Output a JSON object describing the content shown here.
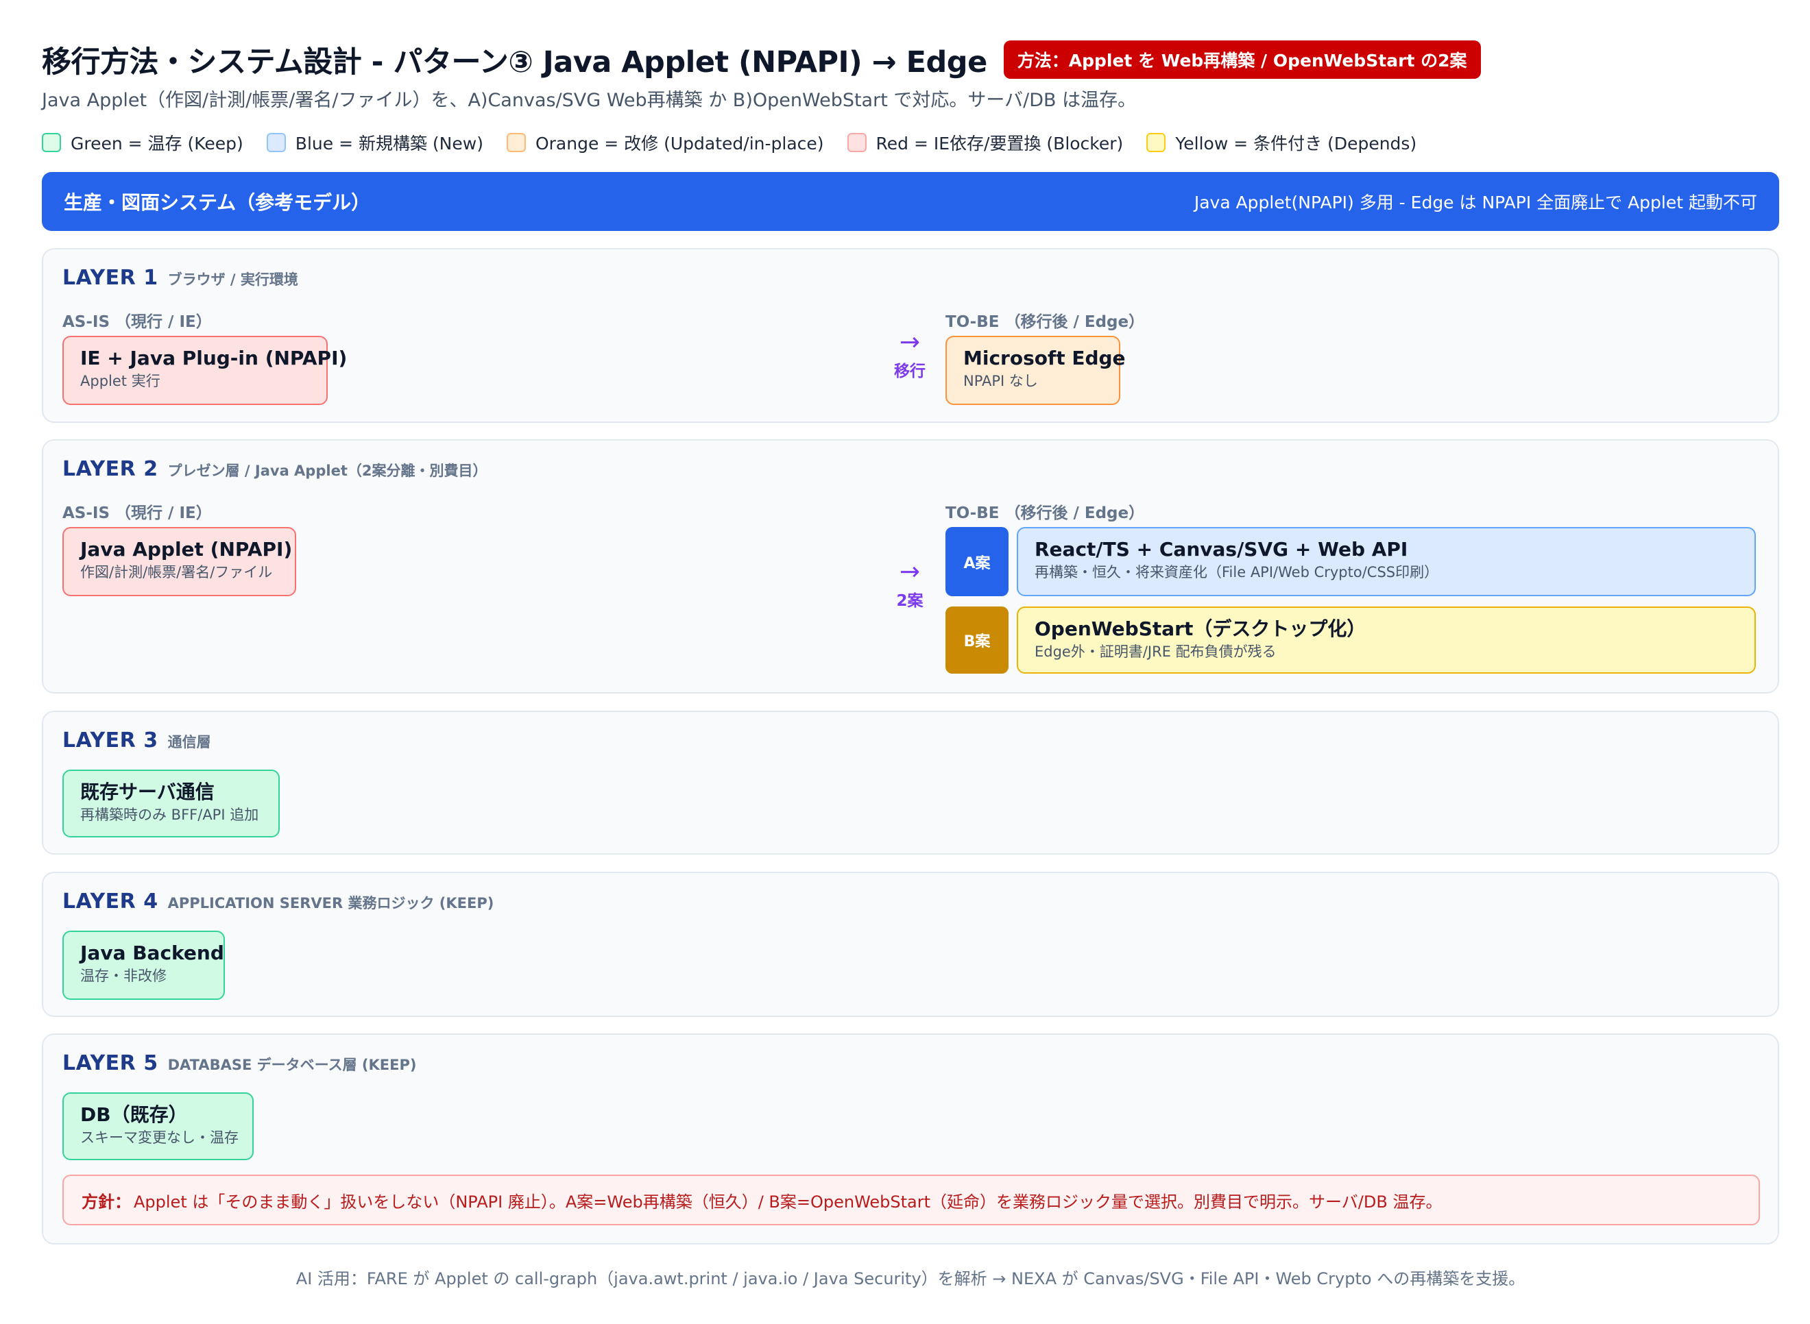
{
  "header": {
    "title": "移行方法・システム設計 - パターン③ Java Applet (NPAPI) → Edge",
    "method_badge": "方法：Applet を Web再構築 / OpenWebStart の2案",
    "subtitle": "Java Applet（作図/計測/帳票/署名/ファイル）を、A)Canvas/SVG Web再構築 か B)OpenWebStart で対応。サーバ/DB は温存。"
  },
  "legend": [
    {
      "label": "Green = 温存 (Keep)",
      "color": "#34d399"
    },
    {
      "label": "Blue = 新規構築 (New)",
      "color": "#93c5fd"
    },
    {
      "label": "Orange = 改修 (Updated/in-place)",
      "color": "#fdba74"
    },
    {
      "label": "Red = IE依存/要置換 (Blocker)",
      "color": "#fca5a5"
    },
    {
      "label": "Yellow = 条件付き (Depends)",
      "color": "#facc15"
    }
  ],
  "system": {
    "title": "生産・図面システム（参考モデル）",
    "note": "Java Applet(NPAPI) 多用 - Edge は NPAPI 全面廃止で Applet 起動不可"
  },
  "columns": {
    "as_is": "AS-IS （現行 / IE）",
    "to_be": "TO-BE （移行後 / Edge）"
  },
  "layers": {
    "l1": {
      "num": "LAYER 1",
      "desc": "ブラウザ / 実行環境",
      "as_is": {
        "title": "IE + Java Plug-in (NPAPI)",
        "sub": "Applet 実行"
      },
      "arrow": {
        "glyph": "→",
        "label": "移行"
      },
      "to_be": {
        "title": "Microsoft Edge",
        "sub": "NPAPI なし"
      }
    },
    "l2": {
      "num": "LAYER 2",
      "desc": "プレゼン層 / Java Applet（2案分離・別費目）",
      "as_is": {
        "title": "Java Applet (NPAPI)",
        "sub": "作図/計測/帳票/署名/ファイル"
      },
      "arrow": {
        "glyph": "→",
        "label": "2案"
      },
      "option_a": {
        "tag": "A案",
        "title": "React/TS + Canvas/SVG + Web API",
        "sub": "再構築・恒久・将来資産化（File API/Web Crypto/CSS印刷）"
      },
      "option_b": {
        "tag": "B案",
        "title": "OpenWebStart（デスクトップ化）",
        "sub": "Edge外・証明書/JRE 配布負債が残る"
      }
    },
    "l3": {
      "num": "LAYER 3",
      "desc": "通信層",
      "node": {
        "title": "既存サーバ通信",
        "sub": "再構築時のみ BFF/API 追加"
      }
    },
    "l4": {
      "num": "LAYER 4",
      "desc": "APPLICATION SERVER 業務ロジック (KEEP)",
      "node": {
        "title": "Java Backend",
        "sub": "温存・非改修"
      }
    },
    "l5": {
      "num": "LAYER 5",
      "desc": "DATABASE データベース層 (KEEP)",
      "node": {
        "title": "DB（既存）",
        "sub": "スキーマ変更なし・温存"
      },
      "policy_label": "方針：",
      "policy_text": "Applet は「そのまま動く」扱いをしない（NPAPI 廃止）。A案=Web再構築（恒久）/ B案=OpenWebStart（延命）を業務ロジック量で選択。別費目で明示。サーバ/DB 温存。"
    }
  },
  "footer": "AI 活用：FARE が Applet の call-graph（java.awt.print / java.io / Java Security）を解析 → NEXA が Canvas/SVG・File API・Web Crypto への再構築を支援。"
}
